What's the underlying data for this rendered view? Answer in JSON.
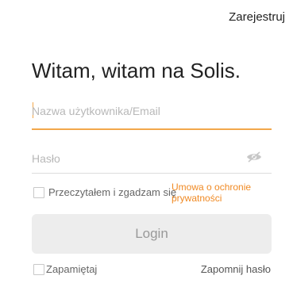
{
  "header": {
    "register_label": "Zarejestruj"
  },
  "main": {
    "title": "Witam, witam na Solis.",
    "username": {
      "placeholder": "Nazwa użytkownika/Email",
      "value": ""
    },
    "password": {
      "placeholder": "Hasło",
      "value": "",
      "toggle_icon": "eye-icon"
    },
    "agreement": {
      "text": "Przeczytałem i zgadzam się",
      "link_text": "Umowa o ochronie prywatności",
      "checked": false
    },
    "login_label": "Login",
    "remember": {
      "label": "Zapamiętaj",
      "checked": false
    },
    "forgot_label": "Zapomnij hasło"
  },
  "colors": {
    "accent": "#f2a74a",
    "link": "#f08a24",
    "button_bg": "#ededed",
    "button_text": "#999999"
  }
}
